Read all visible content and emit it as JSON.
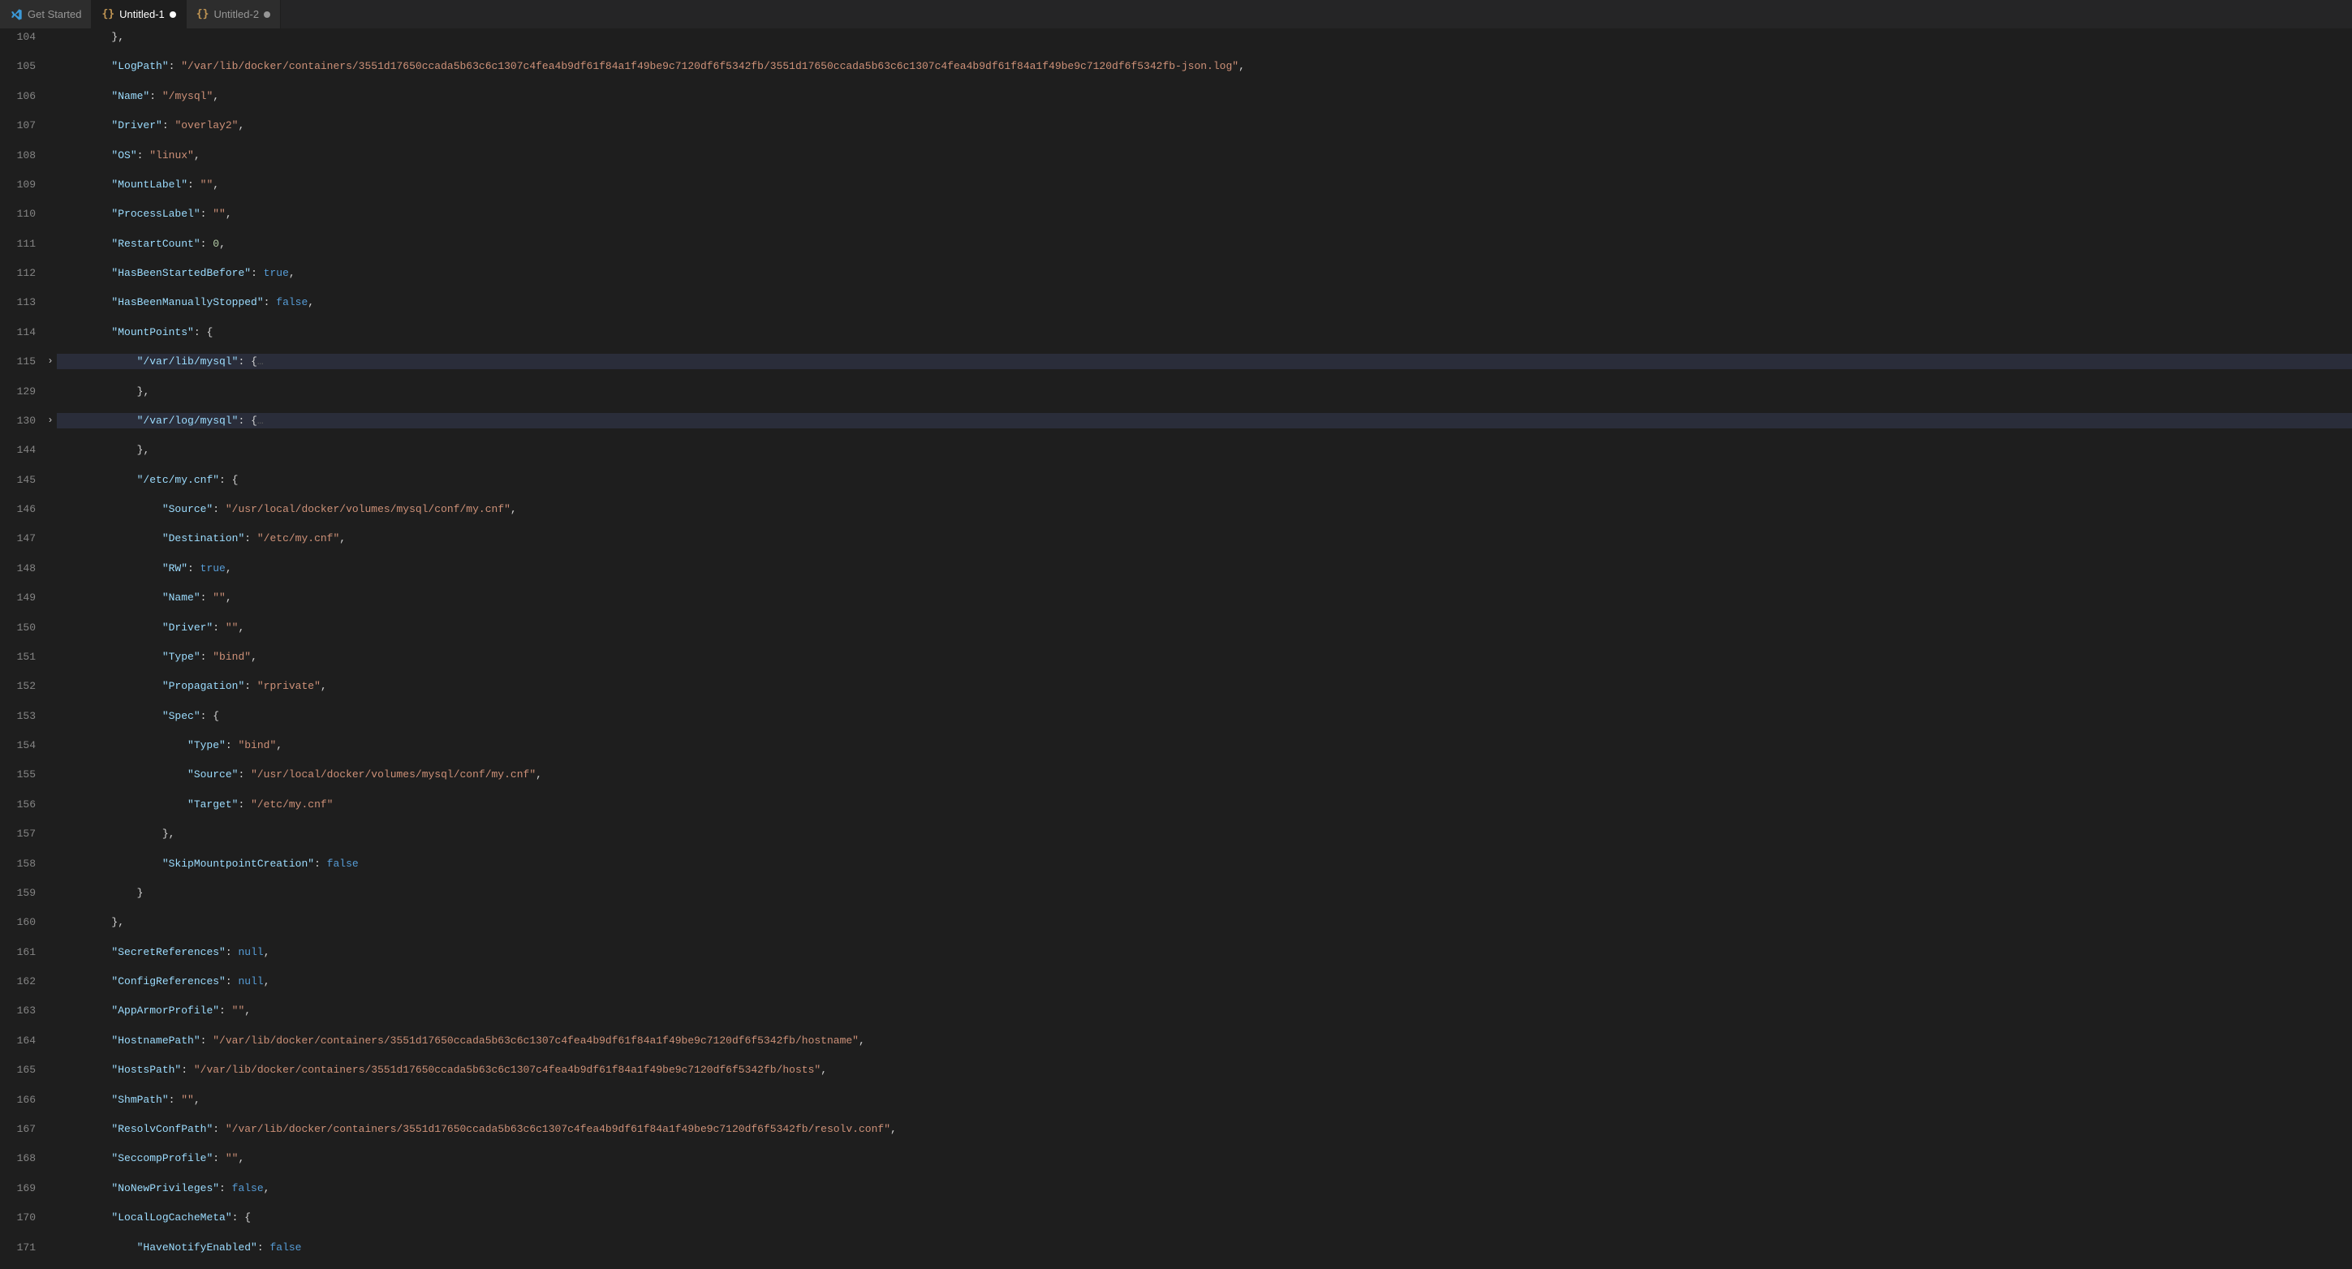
{
  "tabs": [
    {
      "icon": "vscode",
      "label": "Get Started",
      "dirty": false
    },
    {
      "icon": "json",
      "label": "Untitled-1",
      "dirty": true,
      "active": true
    },
    {
      "icon": "json",
      "label": "Untitled-2",
      "dirty": true
    }
  ],
  "colors": {
    "bg": "#1e1e1e",
    "tabBg": "#2d2d2d",
    "activeTab": "#1e1e1e",
    "key": "#9cdcfe",
    "string": "#ce9178",
    "number": "#b5cea8",
    "bool": "#569cd6",
    "lineNum": "#858585",
    "highlight": "#2a2d3a"
  },
  "lines": [
    {
      "n": 104,
      "hl": false,
      "indent": 2,
      "raw": "},",
      "t": [
        [
          "brace",
          "}"
        ],
        [
          "punc",
          ","
        ]
      ]
    },
    {
      "n": 105,
      "hl": false,
      "indent": 2,
      "t": [
        [
          "key",
          "\"LogPath\""
        ],
        [
          "punc",
          ": "
        ],
        [
          "str",
          "\"/var/lib/docker/containers/3551d17650ccada5b63c6c1307c4fea4b9df61f84a1f49be9c7120df6f5342fb/3551d17650ccada5b63c6c1307c4fea4b9df61f84a1f49be9c7120df6f5342fb-json.log\""
        ],
        [
          "punc",
          ","
        ]
      ]
    },
    {
      "n": 106,
      "hl": false,
      "indent": 2,
      "t": [
        [
          "key",
          "\"Name\""
        ],
        [
          "punc",
          ": "
        ],
        [
          "str",
          "\"/mysql\""
        ],
        [
          "punc",
          ","
        ]
      ]
    },
    {
      "n": 107,
      "hl": false,
      "indent": 2,
      "t": [
        [
          "key",
          "\"Driver\""
        ],
        [
          "punc",
          ": "
        ],
        [
          "str",
          "\"overlay2\""
        ],
        [
          "punc",
          ","
        ]
      ]
    },
    {
      "n": 108,
      "hl": false,
      "indent": 2,
      "t": [
        [
          "key",
          "\"OS\""
        ],
        [
          "punc",
          ": "
        ],
        [
          "str",
          "\"linux\""
        ],
        [
          "punc",
          ","
        ]
      ]
    },
    {
      "n": 109,
      "hl": false,
      "indent": 2,
      "t": [
        [
          "key",
          "\"MountLabel\""
        ],
        [
          "punc",
          ": "
        ],
        [
          "str",
          "\"\""
        ],
        [
          "punc",
          ","
        ]
      ]
    },
    {
      "n": 110,
      "hl": false,
      "indent": 2,
      "t": [
        [
          "key",
          "\"ProcessLabel\""
        ],
        [
          "punc",
          ": "
        ],
        [
          "str",
          "\"\""
        ],
        [
          "punc",
          ","
        ]
      ]
    },
    {
      "n": 111,
      "hl": false,
      "indent": 2,
      "t": [
        [
          "key",
          "\"RestartCount\""
        ],
        [
          "punc",
          ": "
        ],
        [
          "num",
          "0"
        ],
        [
          "punc",
          ","
        ]
      ]
    },
    {
      "n": 112,
      "hl": false,
      "indent": 2,
      "t": [
        [
          "key",
          "\"HasBeenStartedBefore\""
        ],
        [
          "punc",
          ": "
        ],
        [
          "bool",
          "true"
        ],
        [
          "punc",
          ","
        ]
      ]
    },
    {
      "n": 113,
      "hl": false,
      "indent": 2,
      "t": [
        [
          "key",
          "\"HasBeenManuallyStopped\""
        ],
        [
          "punc",
          ": "
        ],
        [
          "bool",
          "false"
        ],
        [
          "punc",
          ","
        ]
      ]
    },
    {
      "n": 114,
      "hl": false,
      "indent": 2,
      "t": [
        [
          "key",
          "\"MountPoints\""
        ],
        [
          "punc",
          ": "
        ],
        [
          "brace",
          "{"
        ]
      ]
    },
    {
      "n": 115,
      "hl": true,
      "fold": ">",
      "indent": 3,
      "t": [
        [
          "key",
          "\"/var/lib/mysql\""
        ],
        [
          "punc",
          ": "
        ],
        [
          "brace",
          "{"
        ],
        [
          "fold",
          "…"
        ]
      ]
    },
    {
      "n": 129,
      "hl": false,
      "indent": 3,
      "t": [
        [
          "brace",
          "}"
        ],
        [
          "punc",
          ","
        ]
      ]
    },
    {
      "n": 130,
      "hl": true,
      "fold": ">",
      "indent": 3,
      "t": [
        [
          "key",
          "\"/var/log/mysql\""
        ],
        [
          "punc",
          ": "
        ],
        [
          "brace",
          "{"
        ],
        [
          "fold",
          "…"
        ]
      ]
    },
    {
      "n": 144,
      "hl": false,
      "indent": 3,
      "t": [
        [
          "brace",
          "}"
        ],
        [
          "punc",
          ","
        ]
      ]
    },
    {
      "n": 145,
      "hl": false,
      "indent": 3,
      "t": [
        [
          "key",
          "\"/etc/my.cnf\""
        ],
        [
          "punc",
          ": "
        ],
        [
          "brace",
          "{"
        ]
      ]
    },
    {
      "n": 146,
      "hl": false,
      "indent": 4,
      "t": [
        [
          "key",
          "\"Source\""
        ],
        [
          "punc",
          ": "
        ],
        [
          "str",
          "\"/usr/local/docker/volumes/mysql/conf/my.cnf\""
        ],
        [
          "punc",
          ","
        ]
      ]
    },
    {
      "n": 147,
      "hl": false,
      "indent": 4,
      "t": [
        [
          "key",
          "\"Destination\""
        ],
        [
          "punc",
          ": "
        ],
        [
          "str",
          "\"/etc/my.cnf\""
        ],
        [
          "punc",
          ","
        ]
      ]
    },
    {
      "n": 148,
      "hl": false,
      "indent": 4,
      "t": [
        [
          "key",
          "\"RW\""
        ],
        [
          "punc",
          ": "
        ],
        [
          "bool",
          "true"
        ],
        [
          "punc",
          ","
        ]
      ]
    },
    {
      "n": 149,
      "hl": false,
      "indent": 4,
      "t": [
        [
          "key",
          "\"Name\""
        ],
        [
          "punc",
          ": "
        ],
        [
          "str",
          "\"\""
        ],
        [
          "punc",
          ","
        ]
      ]
    },
    {
      "n": 150,
      "hl": false,
      "indent": 4,
      "t": [
        [
          "key",
          "\"Driver\""
        ],
        [
          "punc",
          ": "
        ],
        [
          "str",
          "\"\""
        ],
        [
          "punc",
          ","
        ]
      ]
    },
    {
      "n": 151,
      "hl": false,
      "indent": 4,
      "t": [
        [
          "key",
          "\"Type\""
        ],
        [
          "punc",
          ": "
        ],
        [
          "str",
          "\"bind\""
        ],
        [
          "punc",
          ","
        ]
      ]
    },
    {
      "n": 152,
      "hl": false,
      "indent": 4,
      "t": [
        [
          "key",
          "\"Propagation\""
        ],
        [
          "punc",
          ": "
        ],
        [
          "str",
          "\"rprivate\""
        ],
        [
          "punc",
          ","
        ]
      ]
    },
    {
      "n": 153,
      "hl": false,
      "indent": 4,
      "t": [
        [
          "key",
          "\"Spec\""
        ],
        [
          "punc",
          ": "
        ],
        [
          "brace",
          "{"
        ]
      ]
    },
    {
      "n": 154,
      "hl": false,
      "indent": 5,
      "t": [
        [
          "key",
          "\"Type\""
        ],
        [
          "punc",
          ": "
        ],
        [
          "str",
          "\"bind\""
        ],
        [
          "punc",
          ","
        ]
      ]
    },
    {
      "n": 155,
      "hl": false,
      "indent": 5,
      "t": [
        [
          "key",
          "\"Source\""
        ],
        [
          "punc",
          ": "
        ],
        [
          "str",
          "\"/usr/local/docker/volumes/mysql/conf/my.cnf\""
        ],
        [
          "punc",
          ","
        ]
      ]
    },
    {
      "n": 156,
      "hl": false,
      "indent": 5,
      "t": [
        [
          "key",
          "\"Target\""
        ],
        [
          "punc",
          ": "
        ],
        [
          "str",
          "\"/etc/my.cnf\""
        ]
      ]
    },
    {
      "n": 157,
      "hl": false,
      "indent": 4,
      "t": [
        [
          "brace",
          "}"
        ],
        [
          "punc",
          ","
        ]
      ]
    },
    {
      "n": 158,
      "hl": false,
      "indent": 4,
      "t": [
        [
          "key",
          "\"SkipMountpointCreation\""
        ],
        [
          "punc",
          ": "
        ],
        [
          "bool",
          "false"
        ]
      ]
    },
    {
      "n": 159,
      "hl": false,
      "indent": 3,
      "t": [
        [
          "brace",
          "}"
        ]
      ]
    },
    {
      "n": 160,
      "hl": false,
      "indent": 2,
      "t": [
        [
          "brace",
          "}"
        ],
        [
          "punc",
          ","
        ]
      ]
    },
    {
      "n": 161,
      "hl": false,
      "indent": 2,
      "t": [
        [
          "key",
          "\"SecretReferences\""
        ],
        [
          "punc",
          ": "
        ],
        [
          "null",
          "null"
        ],
        [
          "punc",
          ","
        ]
      ]
    },
    {
      "n": 162,
      "hl": false,
      "indent": 2,
      "t": [
        [
          "key",
          "\"ConfigReferences\""
        ],
        [
          "punc",
          ": "
        ],
        [
          "null",
          "null"
        ],
        [
          "punc",
          ","
        ]
      ]
    },
    {
      "n": 163,
      "hl": false,
      "indent": 2,
      "t": [
        [
          "key",
          "\"AppArmorProfile\""
        ],
        [
          "punc",
          ": "
        ],
        [
          "str",
          "\"\""
        ],
        [
          "punc",
          ","
        ]
      ]
    },
    {
      "n": 164,
      "hl": false,
      "indent": 2,
      "t": [
        [
          "key",
          "\"HostnamePath\""
        ],
        [
          "punc",
          ": "
        ],
        [
          "str",
          "\"/var/lib/docker/containers/3551d17650ccada5b63c6c1307c4fea4b9df61f84a1f49be9c7120df6f5342fb/hostname\""
        ],
        [
          "punc",
          ","
        ]
      ]
    },
    {
      "n": 165,
      "hl": false,
      "indent": 2,
      "t": [
        [
          "key",
          "\"HostsPath\""
        ],
        [
          "punc",
          ": "
        ],
        [
          "str",
          "\"/var/lib/docker/containers/3551d17650ccada5b63c6c1307c4fea4b9df61f84a1f49be9c7120df6f5342fb/hosts\""
        ],
        [
          "punc",
          ","
        ]
      ]
    },
    {
      "n": 166,
      "hl": false,
      "indent": 2,
      "t": [
        [
          "key",
          "\"ShmPath\""
        ],
        [
          "punc",
          ": "
        ],
        [
          "str",
          "\"\""
        ],
        [
          "punc",
          ","
        ]
      ]
    },
    {
      "n": 167,
      "hl": false,
      "indent": 2,
      "t": [
        [
          "key",
          "\"ResolvConfPath\""
        ],
        [
          "punc",
          ": "
        ],
        [
          "str",
          "\"/var/lib/docker/containers/3551d17650ccada5b63c6c1307c4fea4b9df61f84a1f49be9c7120df6f5342fb/resolv.conf\""
        ],
        [
          "punc",
          ","
        ]
      ]
    },
    {
      "n": 168,
      "hl": false,
      "indent": 2,
      "t": [
        [
          "key",
          "\"SeccompProfile\""
        ],
        [
          "punc",
          ": "
        ],
        [
          "str",
          "\"\""
        ],
        [
          "punc",
          ","
        ]
      ]
    },
    {
      "n": 169,
      "hl": false,
      "indent": 2,
      "t": [
        [
          "key",
          "\"NoNewPrivileges\""
        ],
        [
          "punc",
          ": "
        ],
        [
          "bool",
          "false"
        ],
        [
          "punc",
          ","
        ]
      ]
    },
    {
      "n": 170,
      "hl": false,
      "indent": 2,
      "t": [
        [
          "key",
          "\"LocalLogCacheMeta\""
        ],
        [
          "punc",
          ": "
        ],
        [
          "brace",
          "{"
        ]
      ]
    },
    {
      "n": 171,
      "hl": false,
      "indent": 3,
      "t": [
        [
          "key",
          "\"HaveNotifyEnabled\""
        ],
        [
          "punc",
          ": "
        ],
        [
          "bool",
          "false"
        ]
      ]
    }
  ],
  "indentUnit": "    "
}
